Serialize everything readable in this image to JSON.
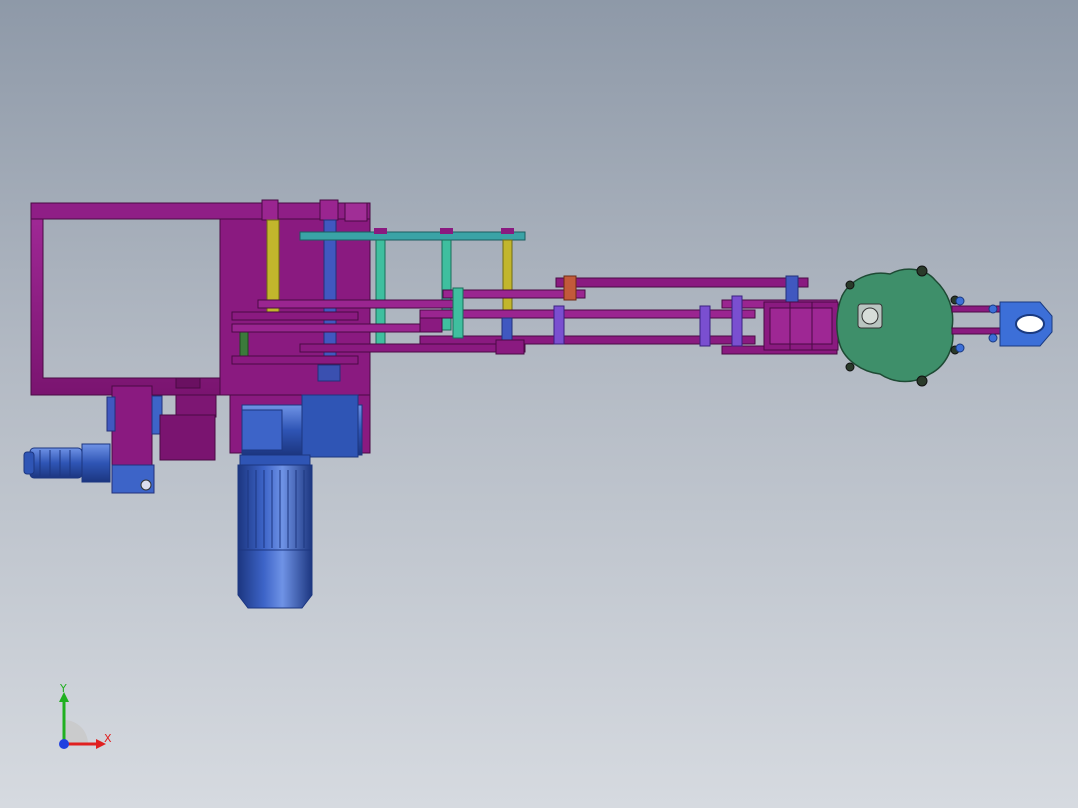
{
  "viewport": {
    "background_top": "#8e99a8",
    "background_bottom": "#d6dae0"
  },
  "colors": {
    "frame": "#8a1a80",
    "frame_dark": "#5e0f58",
    "frame_light": "#b13aa6",
    "motor": "#2f55b5",
    "motor_dark": "#1c3680",
    "motor_light": "#6f93e6",
    "link_cyan": "#3aa3a6",
    "pin_yellow": "#c2b62c",
    "pin_green": "#3fbf9f",
    "pin_blue": "#4058c0",
    "pin_violet": "#7a4fd0",
    "gripper_body": "#3e8f6a",
    "gripper_jaw": "#3c6fd8",
    "axis_x": "#e02020",
    "axis_y": "#20b020",
    "axis_z": "#2040e0"
  },
  "triad": {
    "x_label": "X",
    "y_label": "Y"
  }
}
